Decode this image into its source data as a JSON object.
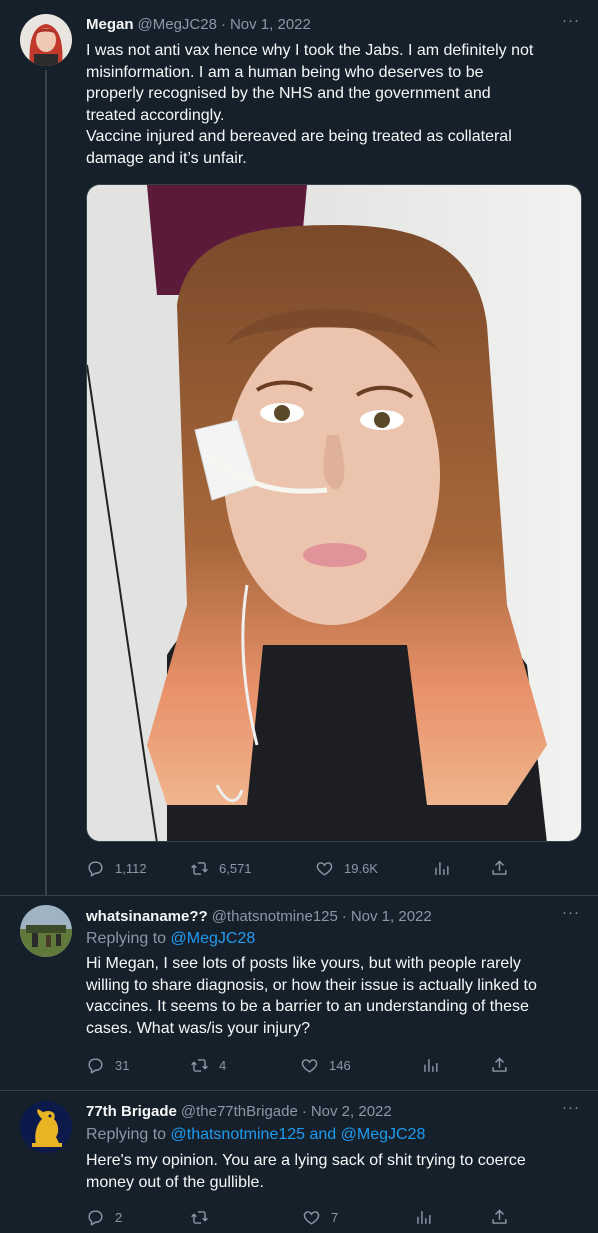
{
  "tweets": [
    {
      "name": "Megan",
      "handle": "@MegJC28",
      "date": "Nov 1, 2022",
      "text_lines": [
        "I was not anti vax hence why I took the Jabs. I am definitely not",
        "misinformation. I am a human being who deserves to be",
        "properly recognised by the NHS and the government and",
        "treated accordingly.",
        "Vaccine injured and bereaved are being treated as collateral",
        "damage and it’s unfair."
      ],
      "stats": {
        "replies": "1,112",
        "retweets": "6,571",
        "likes": "19.6K"
      }
    },
    {
      "name": "whatsinaname??",
      "handle": "@thatsnotmine125",
      "date": "Nov 1, 2022",
      "replying_prefix": "Replying to",
      "replying_to": "@MegJC28",
      "text_lines": [
        "Hi Megan, I see lots of posts like yours, but with people rarely",
        "willing to share diagnosis, or how their issue is actually linked to",
        "vaccines. It seems to be a barrier to an understanding of these",
        "cases. What was/is your injury?"
      ],
      "stats": {
        "replies": "31",
        "retweets": "4",
        "likes": "146"
      }
    },
    {
      "name": "77th Brigade",
      "handle": "@the77thBrigade",
      "date": "Nov 2, 2022",
      "replying_prefix": "Replying to",
      "replying_to": "@thatsnotmine125 and @MegJC28",
      "text_lines": [
        "Here's my opinion. You are a lying sack of shit trying to coerce",
        "money out of the gullible."
      ],
      "stats": {
        "replies": "2",
        "retweets": "",
        "likes": "7"
      }
    }
  ],
  "ui": {
    "separator": "·",
    "more": "···"
  },
  "icons": [
    "reply-icon",
    "retweet-icon",
    "like-icon",
    "views-icon",
    "share-icon",
    "more-icon"
  ],
  "colors": {
    "background": "#15202b",
    "text": "#f7f9f9",
    "muted": "#8b98a5",
    "accent": "#1d9bf0",
    "border": "#38444d"
  }
}
